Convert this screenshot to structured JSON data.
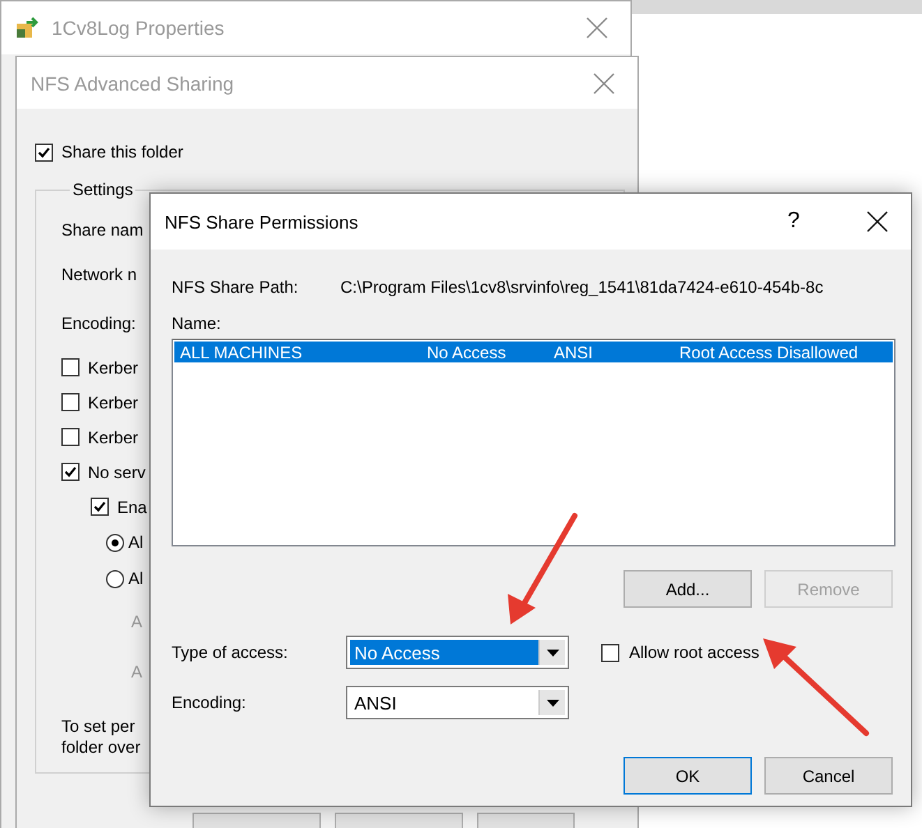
{
  "properties_window": {
    "title": "1Cv8Log Properties"
  },
  "advanced_sharing": {
    "title": "NFS Advanced Sharing",
    "share_checkbox": {
      "label": "Share this folder",
      "checked": true
    },
    "settings": {
      "title": "Settings",
      "items": [
        {
          "kind": "text",
          "label": "Share nam"
        },
        {
          "kind": "text",
          "label": "Network n"
        },
        {
          "kind": "text",
          "label": "Encoding:"
        },
        {
          "kind": "checkbox",
          "label": "Kerber",
          "checked": false
        },
        {
          "kind": "checkbox",
          "label": "Kerber",
          "checked": false
        },
        {
          "kind": "checkbox",
          "label": "Kerber",
          "checked": false
        },
        {
          "kind": "checkbox",
          "label": "No serv",
          "checked": true,
          "children": [
            {
              "kind": "checkbox",
              "label": "Ena",
              "checked": true,
              "children": [
                {
                  "kind": "radio",
                  "label": "Al",
                  "selected": true
                },
                {
                  "kind": "radio",
                  "label": "Al",
                  "selected": false,
                  "children": [
                    {
                      "kind": "dim_text",
                      "label": "A"
                    },
                    {
                      "kind": "dim_text",
                      "label": "A"
                    }
                  ]
                }
              ]
            }
          ]
        },
        {
          "kind": "note",
          "lines": [
            "To set per",
            "folder over"
          ]
        }
      ]
    }
  },
  "permissions": {
    "title": "NFS Share Permissions",
    "help": "?",
    "path_label": "NFS Share Path:",
    "path": "C:\\Program Files\\1cv8\\srvinfo\\reg_1541\\81da7424-e610-454b-8c",
    "name_label": "Name:",
    "rows": [
      {
        "cells": [
          "ALL MACHINES",
          "No Access",
          "ANSI",
          "Root Access Disallowed"
        ],
        "selected": true
      }
    ],
    "add_button": {
      "label": "Add...",
      "disabled": false
    },
    "remove_button": {
      "label": "Remove",
      "disabled": true
    },
    "type_label": "Type of access:",
    "type_value": "No Access",
    "type_focused": true,
    "root_checkbox": {
      "label": "Allow root access",
      "checked": false
    },
    "encoding_label": "Encoding:",
    "encoding_value": "ANSI",
    "encoding_focused": false,
    "ok_button": "OK",
    "cancel_button": "Cancel"
  }
}
